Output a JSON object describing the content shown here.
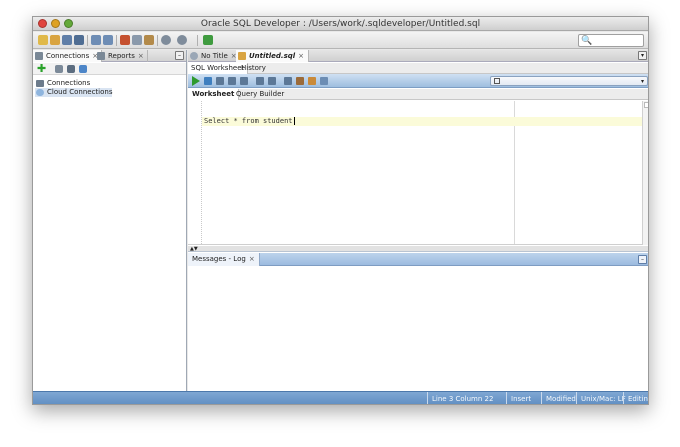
{
  "window": {
    "title": "Oracle SQL Developer : /Users/work/.sqldeveloper/Untitled.sql"
  },
  "colors": {
    "accent_blue": "#9ebedf",
    "status_blue": "#5d8cc1",
    "run_green": "#2e9a2e",
    "current_line": "#fbfbd9"
  },
  "left_panel": {
    "tabs": [
      {
        "label": "Connections",
        "close": "×",
        "icon": "connections-icon"
      },
      {
        "label": "Reports",
        "close": "×",
        "icon": "reports-icon"
      }
    ],
    "minimize_glyph": "–",
    "tools": {
      "add_glyph": "✚"
    },
    "tree": [
      {
        "label": "Connections",
        "icon": "database-icon"
      },
      {
        "label": "Cloud Connections",
        "icon": "cloud-icon"
      }
    ]
  },
  "editor_area": {
    "doc_tabs": [
      {
        "label": "No Title",
        "close": "×",
        "icon": "help-icon"
      },
      {
        "label": "Untitled.sql",
        "close": "×",
        "icon": "sql-file-icon"
      }
    ],
    "doc_menu_glyph": "▾",
    "sub_tabs": [
      {
        "label": "SQL Worksheet"
      },
      {
        "label": "History"
      }
    ],
    "connection_select": {
      "arrow": "▾"
    },
    "worksheet_tabs": [
      {
        "label": "Worksheet"
      },
      {
        "label": "Query Builder"
      }
    ],
    "sql_text": "Select * from student",
    "split_arrows": "▲▼"
  },
  "messages": {
    "tab_label": "Messages - Log",
    "close": "×",
    "minimize_glyph": "–"
  },
  "search": {
    "glyph": "🔍"
  },
  "status_bar": {
    "position": "Line 3 Column 22",
    "mode": "Insert",
    "modified": "Modified",
    "line_endings": "Unix/Mac: LF",
    "state": "Editing"
  }
}
